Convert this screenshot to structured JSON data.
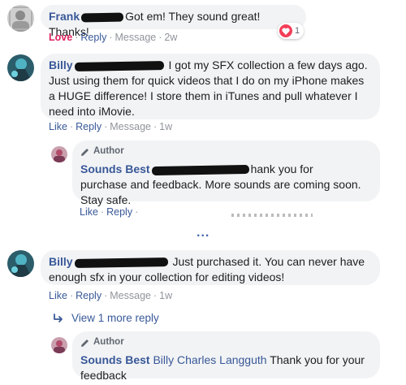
{
  "comments": [
    {
      "name": "Frank",
      "text": "Got em! They sound great! Thanks!",
      "actions": {
        "love": "Love",
        "reply": "Reply",
        "message": "Message",
        "time": "2w"
      },
      "reaction": {
        "icon": "heart-icon",
        "count": "1"
      }
    },
    {
      "name": "Billy",
      "text_line1": "I got my SFX collection a few days ago.",
      "text_rest": "Just using them for quick videos that I do on my iPhone makes a HUGE difference! I store them in iTunes and pull whatever I need into iMovie.",
      "actions": {
        "like": "Like",
        "reply": "Reply",
        "message": "Message",
        "time": "1w"
      },
      "reply": {
        "author_label": "Author",
        "name": "Sounds Best",
        "text_line1": "hank you for",
        "text_rest": "purchase and feedback. More sounds are coming soon. Stay safe.",
        "actions": {
          "like": "Like",
          "reply": "Reply"
        }
      }
    },
    {
      "name": "Billy",
      "text_line1": "Just purchased it. You can never have",
      "text_rest": "enough sfx in your collection for editing videos!",
      "actions": {
        "like": "Like",
        "reply": "Reply",
        "message": "Message",
        "time": "1w"
      },
      "view_more": "View 1 more reply",
      "reply": {
        "author_label": "Author",
        "name": "Sounds Best",
        "tag": "Billy Charles Langguth",
        "text_line1": "Thank you for your",
        "text_rest": "feedback"
      }
    }
  ],
  "more_dots": "...",
  "colors": {
    "link": "#385898",
    "bubble": "#f2f3f5",
    "love": "#e0245e",
    "muted": "#90949c"
  }
}
